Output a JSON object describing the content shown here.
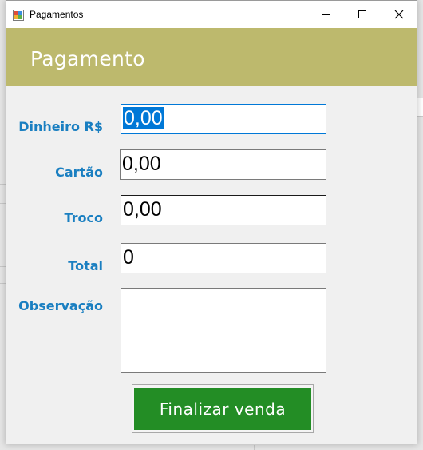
{
  "window": {
    "title": "Pagamentos",
    "header": "Pagamento"
  },
  "form": {
    "dinheiro_label": "Dinheiro R$",
    "dinheiro_value": "0,00",
    "cartao_label": "Cartão",
    "cartao_value": "0,00",
    "troco_label": "Troco",
    "troco_value": "0,00",
    "total_label": "Total",
    "total_value": "0",
    "observacao_label": "Observação",
    "observacao_value": ""
  },
  "actions": {
    "finish_label": "Finalizar venda"
  },
  "colors": {
    "header_band": "#bdb96d",
    "label_text": "#1a7fc1",
    "finish_button": "#238d25",
    "selection": "#0078d7"
  },
  "icons": {
    "app": "app-window-icon",
    "minimize": "minimize-icon",
    "maximize": "maximize-icon",
    "close": "close-icon"
  }
}
